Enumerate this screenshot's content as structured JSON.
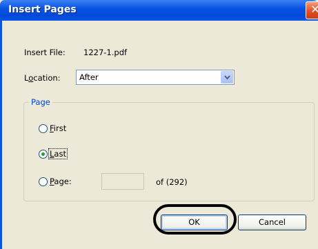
{
  "dialog": {
    "title": "Insert Pages",
    "close_glyph": "✕",
    "insert_file_label": "Insert File:",
    "insert_file_value": "1227-1.pdf",
    "location": {
      "label_accel": "o",
      "label_pre": "L",
      "label_post": "cation:",
      "selected": "After"
    },
    "page_group": {
      "legend": "Page",
      "first": {
        "accel": "F",
        "rest": "irst",
        "checked": false
      },
      "last": {
        "accel": "L",
        "rest": "ast",
        "checked": true
      },
      "page": {
        "accel": "P",
        "rest": "age:",
        "checked": false
      },
      "page_input_value": "",
      "of_text": "of (292)"
    },
    "ok_label": "OK",
    "cancel_label": "Cancel"
  }
}
